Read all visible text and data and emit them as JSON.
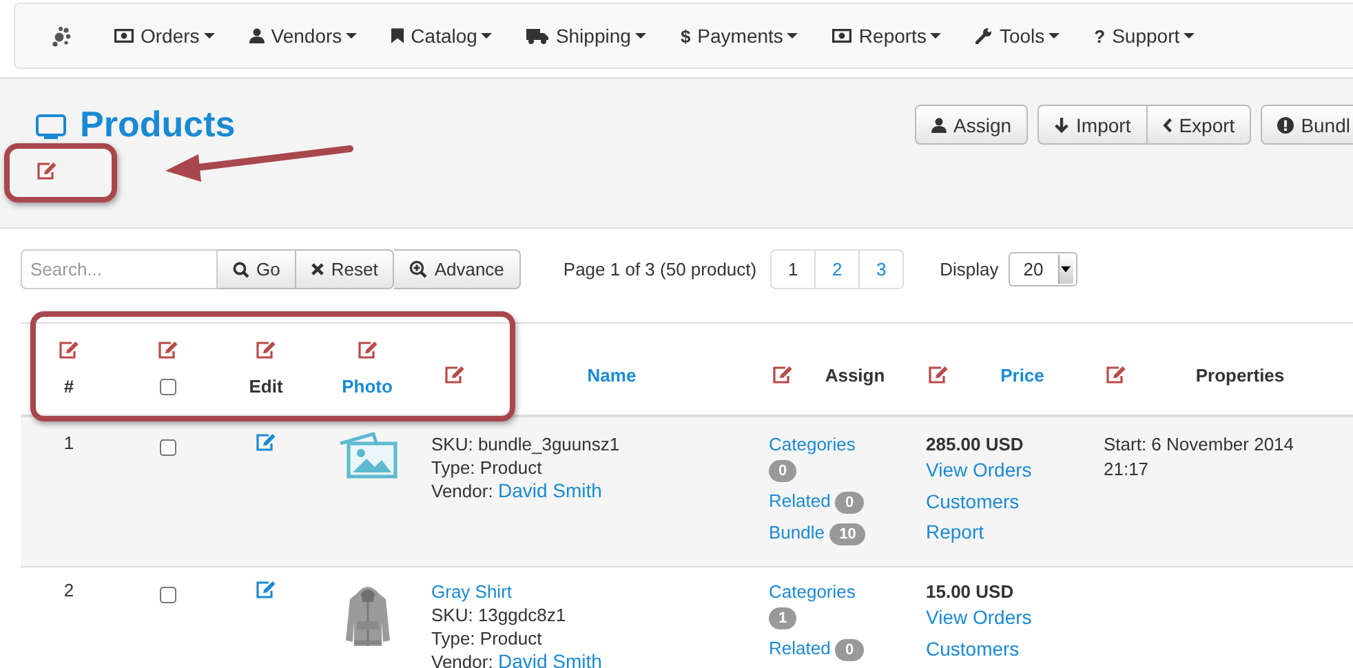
{
  "navbar": {
    "items": [
      {
        "label": "Orders"
      },
      {
        "label": "Vendors"
      },
      {
        "label": "Catalog"
      },
      {
        "label": "Shipping"
      },
      {
        "label": "Payments",
        "glyph": "$"
      },
      {
        "label": "Reports"
      },
      {
        "label": "Tools"
      },
      {
        "label": "Support",
        "glyph": "?"
      }
    ]
  },
  "header": {
    "title": "Products",
    "actions": [
      [
        {
          "label": "Assign"
        }
      ],
      [
        {
          "label": "Import"
        },
        {
          "label": "Export"
        }
      ],
      [
        {
          "label": "Bundl"
        }
      ]
    ]
  },
  "toolbar": {
    "search": {
      "placeholder": "Search..."
    },
    "buttons": [
      {
        "label": "Go"
      },
      {
        "label": "Reset"
      },
      {
        "label": "Advance"
      }
    ],
    "page_info": "Page 1 of 3 (50 product)",
    "pages": [
      {
        "label": "1",
        "selected": true
      },
      {
        "label": "2",
        "selected": false
      },
      {
        "label": "3",
        "selected": false
      }
    ],
    "display": {
      "label": "Display",
      "value": "20"
    }
  },
  "table": {
    "columns": [
      {
        "kind": "number",
        "label": "#",
        "sortable": false
      },
      {
        "kind": "checkbox",
        "checked": false
      },
      {
        "kind": "edit",
        "label": "Edit",
        "sortable": false
      },
      {
        "label": "Photo",
        "sortable": true
      },
      {
        "kind": "name",
        "label": "Name",
        "sortable": true
      },
      {
        "kind": "assign",
        "label": "Assign",
        "sortable": false
      },
      {
        "kind": "price",
        "label": "Price",
        "sortable": true
      },
      {
        "kind": "properties",
        "label": "Properties",
        "sortable": false
      }
    ],
    "rows": [
      {
        "number": "1",
        "checked": false,
        "photo": {
          "kind": "placeholder"
        },
        "name": {
          "lines": [
            "SKU: bundle_3guunsz1",
            "Type: Product"
          ],
          "vendor_label": "Vendor:",
          "vendor": "David Smith"
        },
        "assign": [
          {
            "label": "Categories",
            "badge": "0"
          },
          {
            "label": "Related",
            "badge": "0"
          },
          {
            "label": "Bundle",
            "badge": "10"
          }
        ],
        "price": {
          "amount": "285.00 USD",
          "links": [
            "View Orders",
            "Customers",
            "Report"
          ]
        },
        "properties": "Start: 6 November 2014 21:17"
      },
      {
        "number": "2",
        "checked": false,
        "photo": {
          "kind": "picture"
        },
        "name": {
          "title": "Gray Shirt",
          "lines": [
            "SKU: 13ggdc8z1",
            "Type: Product"
          ],
          "vendor_label": "Vendor:",
          "vendor": "David Smith"
        },
        "assign": [
          {
            "label": "Categories",
            "badge": "1"
          },
          {
            "label": "Related",
            "badge": "0"
          }
        ],
        "price": {
          "amount": "15.00 USD",
          "links": [
            "View Orders",
            "Customers"
          ]
        }
      }
    ]
  }
}
